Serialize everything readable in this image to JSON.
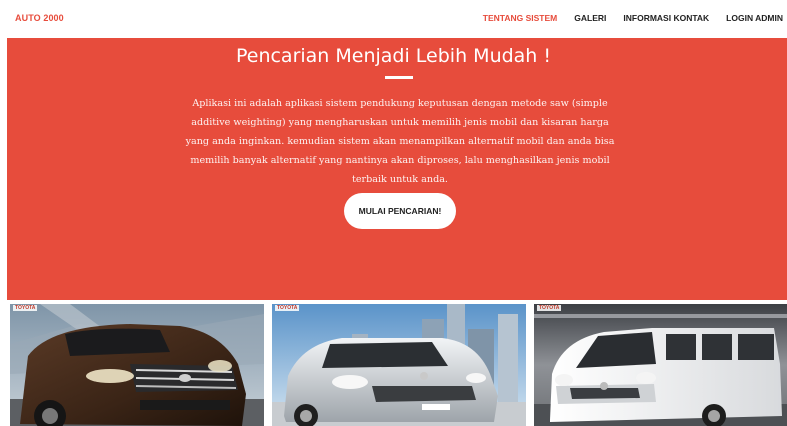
{
  "navbar": {
    "brand": "AUTO 2000",
    "links": [
      "TENTANG SISTEM",
      "GALERI",
      "INFORMASI KONTAK",
      "LOGIN ADMIN"
    ],
    "active_index": 0
  },
  "hero": {
    "title": "Pencarian Menjadi Lebih Mudah !",
    "description": "Aplikasi ini adalah aplikasi sistem pendukung keputusan dengan metode saw (simple additive weighting) yang mengharuskan untuk memilih jenis mobil dan kisaran harga yang anda inginkan. kemudian sistem akan menampilkan alternatif mobil dan anda bisa memilih banyak alternatif yang nantinya akan diproses, lalu menghasilkan jenis mobil terbaik untuk anda.",
    "button_label": "MULAI PENCARIAN!"
  },
  "gallery": {
    "brand_tag": "TOYOTA",
    "cars": [
      "fortuner-suv-photo",
      "agya-hatchback-photo",
      "hiace-van-photo"
    ]
  },
  "colors": {
    "accent": "#e74c3c",
    "nav_text": "#222222",
    "background": "#ffffff"
  }
}
